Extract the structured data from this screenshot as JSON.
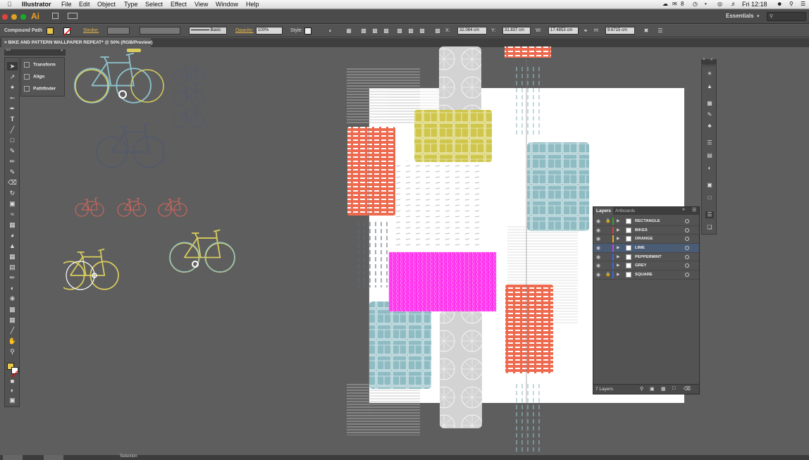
{
  "menubar": {
    "app_name": "Illustrator",
    "items": [
      "File",
      "Edit",
      "Object",
      "Type",
      "Select",
      "Effect",
      "View",
      "Window",
      "Help"
    ],
    "badge_count": "8",
    "clock": "Fri 12:18"
  },
  "appbar": {
    "logo": "Ai",
    "workspace": "Essentials"
  },
  "control": {
    "selection_type": "Compound Path",
    "stroke_label": "Stroke:",
    "brush_value": "Basic",
    "opacity_label": "Opacity:",
    "opacity_value": "100%",
    "style_label": "Style:",
    "x_label": "X:",
    "x_value": "32.084 cm",
    "y_label": "Y:",
    "y_value": "31.837 cm",
    "w_label": "W:",
    "w_value": "17.4853 cm",
    "h_label": "H:",
    "h_value": "9.6715 cm"
  },
  "document": {
    "tab_title": "BIKE AND PATTERN WALLPAPER REPEAT* @ 50% (RGB/Preview)"
  },
  "float_panel": {
    "items": [
      "Transform",
      "Align",
      "Pathfinder"
    ]
  },
  "layers_panel": {
    "tab_layers": "Layers",
    "tab_artboards": "Artboards",
    "layers": [
      {
        "name": "RECTANGLE",
        "color": "#2fa32f",
        "locked": true,
        "selected": false
      },
      {
        "name": "BIKES",
        "color": "#e03a3a",
        "locked": false,
        "selected": false
      },
      {
        "name": "ORANGE",
        "color": "#e0b020",
        "locked": false,
        "selected": false
      },
      {
        "name": "LIME",
        "color": "#cc44cc",
        "locked": false,
        "selected": true
      },
      {
        "name": "PEPPERMINT",
        "color": "#3366ee",
        "locked": false,
        "selected": false
      },
      {
        "name": "GREY",
        "color": "#3366ee",
        "locked": false,
        "selected": false
      },
      {
        "name": "SQUARE",
        "color": "#3366ee",
        "locked": true,
        "selected": false
      }
    ],
    "count_label": "7 Layers"
  },
  "status": {
    "tool": "Selection"
  },
  "colors": {
    "orange_red": "#ee6a4f",
    "lime": "#cfc64b",
    "peppermint": "#8fbcc3",
    "grey": "#d3d3d3",
    "magenta": "#ff33ee",
    "bike_dark": "#555a6a",
    "bike_red": "#d2665c",
    "bike_yellow": "#d8cc5c",
    "bike_teal": "#8cbfc9"
  }
}
